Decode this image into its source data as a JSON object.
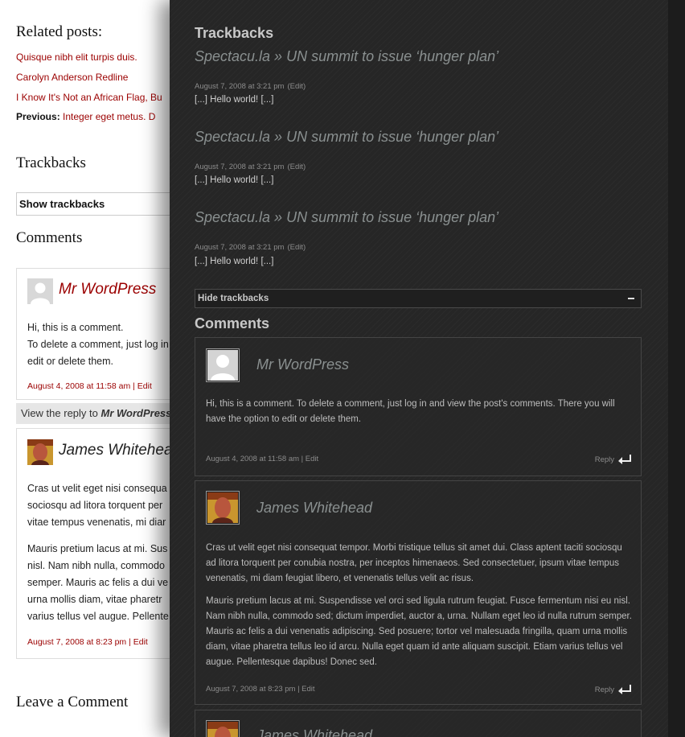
{
  "light": {
    "related_heading": "Related posts:",
    "related_links": [
      "Quisque nibh elit turpis duis.",
      "Carolyn Anderson Redline",
      "I Know It's Not an African Flag, Bu"
    ],
    "previous_label": "Previous:",
    "previous_link": "Integer eget metus. D",
    "trackbacks_heading": "Trackbacks",
    "show_trackbacks_label": "Show trackbacks",
    "comments_heading": "Comments",
    "comments": [
      {
        "author": "Mr WordPress",
        "lines": [
          "Hi, this is a comment.",
          "To delete a comment, just log in",
          "edit or delete them."
        ],
        "meta": "August 4, 2008 at 11:58 am | Edit"
      },
      {
        "author": "James Whitehead",
        "paragraph1": [
          "Cras ut velit eget nisi consequa",
          "sociosqu ad litora torquent per",
          "vitae tempus venenatis, mi diar"
        ],
        "paragraph2": [
          "Mauris pretium lacus at mi. Sus",
          "nisl. Nam nibh nulla, commodo",
          "semper. Mauris ac felis a dui ve",
          "urna mollis diam, vitae pharetr",
          "varius tellus vel augue. Pellente"
        ],
        "meta": "August 7, 2008 at 8:23 pm | Edit"
      }
    ],
    "view_reply_prefix": "View the reply to ",
    "view_reply_author": "Mr WordPress",
    "leave_comment_heading": "Leave a Comment"
  },
  "dark": {
    "trackbacks_heading": "Trackbacks",
    "trackbacks": [
      {
        "title": "Spectacu.la » UN summit to issue ‘hunger plan’",
        "date": "August 7, 2008 at 3:21 pm",
        "edit": "(Edit)",
        "excerpt": "[...] Hello world! [...]"
      },
      {
        "title": "Spectacu.la » UN summit to issue ‘hunger plan’",
        "date": "August 7, 2008 at 3:21 pm",
        "edit": "(Edit)",
        "excerpt": "[...] Hello world! [...]"
      },
      {
        "title": "Spectacu.la » UN summit to issue ‘hunger plan’",
        "date": "August 7, 2008 at 3:21 pm",
        "edit": "(Edit)",
        "excerpt": "[...] Hello world! [...]"
      }
    ],
    "hide_trackbacks_label": "Hide trackbacks",
    "comments_heading": "Comments",
    "comments": [
      {
        "author": "Mr WordPress",
        "paragraphs": [
          "Hi, this is a comment. To delete a comment, just log in and view the post's comments. There you will have the option to edit or delete them."
        ],
        "meta": "August 4, 2008 at 11:58 am | Edit",
        "reply_label": "Reply"
      },
      {
        "author": "James Whitehead",
        "paragraphs": [
          "Cras ut velit eget nisi consequat tempor. Morbi tristique tellus sit amet dui. Class aptent taciti sociosqu ad litora torquent per conubia nostra, per inceptos himenaeos. Sed consectetuer, ipsum vitae tempus venenatis, mi diam feugiat libero, et venenatis tellus velit ac risus.",
          "Mauris pretium lacus at mi. Suspendisse vel orci sed ligula rutrum feugiat. Fusce fermentum nisi eu nisl. Nam nibh nulla, commodo sed; dictum imperdiet, auctor a, urna. Nullam eget leo id nulla rutrum semper. Mauris ac felis a dui venenatis adipiscing. Sed posuere; tortor vel malesuada fringilla, quam urna mollis diam, vitae pharetra tellus leo id arcu. Nulla eget quam id ante aliquam suscipit. Etiam varius tellus vel augue. Pellentesque dapibus! Donec sed."
        ],
        "meta": "August 7, 2008 at 8:23 pm | Edit",
        "reply_label": "Reply"
      },
      {
        "author": "James Whitehead"
      }
    ]
  },
  "colors": {
    "light_link": "#9b0000",
    "dark_bg": "#262626",
    "dark_title": "#8a9090"
  },
  "icons": [
    "default-avatar-icon",
    "user-photo-avatar-icon",
    "reply-arrow-icon",
    "collapse-minus-icon"
  ]
}
